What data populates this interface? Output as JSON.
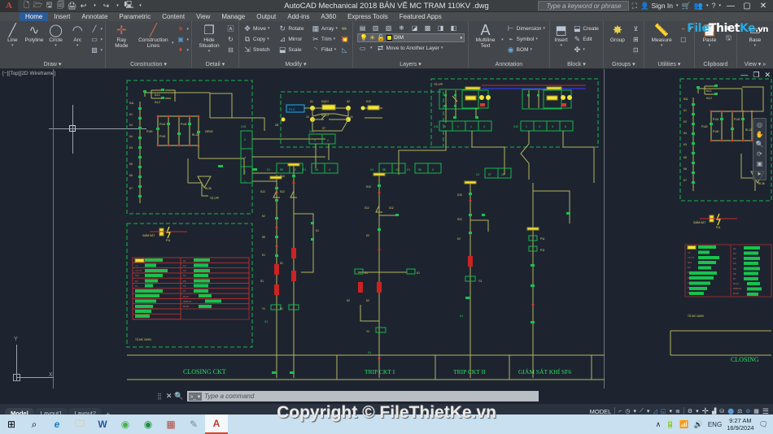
{
  "titlebar": {
    "app_icon": "autocad-A",
    "title": "AutoCAD Mechanical 2018    BẢN VẼ MC TRẠM 110KV  .dwg",
    "search_placeholder": "Type a keyword or phrase",
    "sign_in": "Sign In",
    "qat": [
      "new-icon",
      "open-icon",
      "save-icon",
      "saveas-icon",
      "plot-icon",
      "undo-icon",
      "redo-icon",
      "workspace-icon"
    ],
    "window_buttons": {
      "minimize": "—",
      "maximize": "▢",
      "close": "✕"
    }
  },
  "ribbon": {
    "tabs": [
      {
        "label": "Home",
        "active": true
      },
      {
        "label": "Insert",
        "active": false
      },
      {
        "label": "Annotate",
        "active": false
      },
      {
        "label": "Parametric",
        "active": false
      },
      {
        "label": "Content",
        "active": false
      },
      {
        "label": "View",
        "active": false
      },
      {
        "label": "Manage",
        "active": false
      },
      {
        "label": "Output",
        "active": false
      },
      {
        "label": "Add-ins",
        "active": false
      },
      {
        "label": "A360",
        "active": false
      },
      {
        "label": "Express Tools",
        "active": false
      },
      {
        "label": "Featured Apps",
        "active": false
      }
    ],
    "panels": [
      {
        "title": "Draw",
        "big_buttons": [
          {
            "label": "Line",
            "icon": "line-icon"
          },
          {
            "label": "Polyline",
            "icon": "polyline-icon"
          },
          {
            "label": "Circle",
            "icon": "circle-icon"
          },
          {
            "label": "Arc",
            "icon": "arc-icon"
          }
        ],
        "small_icons": [
          "hatch-line-icon",
          "rectangle-icon",
          "gradient-icon"
        ]
      },
      {
        "title": "Construction",
        "big_buttons": [
          {
            "label": "Ray\nMode",
            "icon": "ray-mode-icon"
          },
          {
            "label": "Construction\nLines",
            "icon": "construction-lines-icon"
          }
        ],
        "small_icons": [
          "centerline-icon",
          "holechart-icon",
          "fit-icon"
        ]
      },
      {
        "title": "Detail",
        "big_buttons": [
          {
            "label": "Hide\nSituation",
            "icon": "hide-situation-icon"
          }
        ],
        "small_icons": [
          "detail-a-icon",
          "revision-icon",
          "symbol-detail-icon"
        ]
      },
      {
        "title": "Modify",
        "commands": [
          {
            "label": "Move",
            "icon": "move-icon"
          },
          {
            "label": "Rotate",
            "icon": "rotate-icon"
          },
          {
            "label": "Array",
            "icon": "array-icon"
          },
          {
            "label": "Copy",
            "icon": "copy-icon"
          },
          {
            "label": "Mirror",
            "icon": "mirror-icon"
          },
          {
            "label": "Trim",
            "icon": "trim-icon"
          },
          {
            "label": "Stretch",
            "icon": "stretch-icon"
          },
          {
            "label": "Scale",
            "icon": "scale-icon"
          },
          {
            "label": "Fillet",
            "icon": "fillet-icon"
          }
        ],
        "extra_icons": [
          "edit-polyline-icon",
          "explode-icon",
          "chamfer-icon"
        ]
      },
      {
        "title": "Layers",
        "layer_icons": [
          "layer-prop-icon",
          "layer-iso-icon",
          "layer-unIso-icon",
          "layer-freeze-icon",
          "layer-off-icon",
          "layer-lock-icon",
          "layer-match-icon",
          "layer-prev-icon"
        ],
        "current_layer": "DIM",
        "layer_color": "#f5e11a",
        "sub_command": "Move to Another Layer"
      },
      {
        "title": "Annotation",
        "big_buttons": [
          {
            "label": "Multiline\nText",
            "icon": "mtext-icon"
          }
        ],
        "commands": [
          {
            "label": "Dimension",
            "icon": "dimension-icon"
          },
          {
            "label": "Symbol",
            "icon": "symbol-icon"
          },
          {
            "label": "BOM",
            "icon": "bom-icon"
          }
        ]
      },
      {
        "title": "Block",
        "big_buttons": [
          {
            "label": "Insert",
            "icon": "insert-block-icon"
          }
        ],
        "commands": [
          {
            "label": "Create",
            "icon": "create-block-icon"
          },
          {
            "label": "Edit",
            "icon": "edit-block-icon"
          }
        ],
        "extra_icons": [
          "block-attr-icon"
        ]
      },
      {
        "title": "Groups",
        "big_buttons": [
          {
            "label": "Group",
            "icon": "group-icon"
          }
        ],
        "small_icons": [
          "ungroup-icon",
          "group-edit-icon",
          "group-select-icon"
        ]
      },
      {
        "title": "Utilities",
        "big_buttons": [
          {
            "label": "Measure",
            "icon": "measure-icon"
          }
        ],
        "small_icons": [
          "quick-calc-icon",
          "point-style-icon"
        ]
      },
      {
        "title": "Clipboard",
        "big_buttons": [
          {
            "label": "Paste",
            "icon": "paste-icon"
          }
        ],
        "small_icons": [
          "copy-clip-icon",
          "paste-special-icon"
        ]
      },
      {
        "title": "View",
        "big_buttons": [
          {
            "label": "Base",
            "icon": "base-view-icon"
          }
        ]
      }
    ],
    "brand_watermark": {
      "part1": "File",
      "part2": "Thiet",
      "part3": "Ke",
      "part4": ".vn"
    }
  },
  "canvas": {
    "viewport_label": "[−][Top][2D Wireframe]",
    "ucs_x": "X",
    "ucs_y": "Y",
    "section_labels": [
      {
        "text": "CLOSING CKT"
      },
      {
        "text": "TRIP CKT I"
      },
      {
        "text": "TRIP CKT II"
      },
      {
        "text": "GIÁM SÁT KHÍ SF6"
      },
      {
        "text": "CLOSING"
      }
    ],
    "drawing_notes": [
      "TỦ LPP",
      "TỦ MC 110KV",
      "TỦ MC 110KV",
      "PLC",
      "KQ0.2",
      "KQ0.2",
      "KQ0.2",
      "K10",
      "K20",
      "X15",
      "X41",
      "X11",
      "X12",
      "X1",
      "X1",
      "X1",
      "X1",
      "X2",
      "S41",
      "S42",
      "S43",
      "S44",
      "RL1A",
      "RL1B",
      "RL16",
      "S7",
      "S12",
      "S13",
      "S19",
      "K1",
      "K2",
      "K3",
      "K4",
      "K5",
      "K6",
      "K7",
      "S4L",
      "S5",
      "Y1",
      "Y2",
      "Y3",
      "P11",
      "K20"
    ],
    "legend_tables": [
      {
        "left_rows": [
          "X1",
          "Y1",
          "Y2,Y3",
          "S12",
          "K2",
          "K5",
          "S13",
          "S5",
          "P2",
          "S1",
          "P11",
          "S7"
        ],
        "right_rows": [
          "K1",
          "K2",
          "K3",
          "K4",
          "K5",
          "K6",
          "K7",
          "RL12",
          "20RL16",
          "RL36"
        ]
      }
    ]
  },
  "command_line": {
    "placeholder": "Type a command",
    "chip": "command-prompt-icon",
    "close_icon": "✕",
    "search_icon": "search-icon"
  },
  "status_bar": {
    "layout_tabs": [
      {
        "label": "Model",
        "active": true
      },
      {
        "label": "Layout1",
        "active": false
      },
      {
        "label": "Layout2",
        "active": false
      }
    ],
    "add_layout": "+",
    "space_mode": "MODEL",
    "toggles": [
      "ortho-icon",
      "polar-tracking-icon",
      "osnap-icon",
      "isometric-icon",
      "annotation-visibility-icon",
      "annotation-scale-icon",
      "workspace-icon",
      "customization-icon",
      "hardware-accel-icon",
      "isolate-objects-icon",
      "clean-screen-icon",
      "fullscreen-icon",
      "menu-icon"
    ]
  },
  "watermark": "Copyright © FileThietKe.vn",
  "taskbar": {
    "items": [
      {
        "name": "start-button",
        "glyph": "⊞"
      },
      {
        "name": "search-button",
        "glyph": "⌕"
      },
      {
        "name": "edge-icon",
        "glyph": "e"
      },
      {
        "name": "file-explorer-icon",
        "glyph": "🗀"
      },
      {
        "name": "word-icon",
        "glyph": "W"
      },
      {
        "name": "unikey-icon",
        "glyph": "◉"
      },
      {
        "name": "chrome-icon",
        "glyph": "◉"
      },
      {
        "name": "app-icon",
        "glyph": "▦"
      },
      {
        "name": "paint-icon",
        "glyph": "✎"
      },
      {
        "name": "autocad-icon",
        "glyph": "A",
        "selected": true
      }
    ],
    "tray": {
      "chevron": "∧",
      "icons": [
        "battery-icon",
        "network-icon",
        "volume-icon"
      ],
      "language": "ENG",
      "time": "9:27 AM",
      "date": "16/9/2024",
      "notifications": "notification-icon"
    }
  }
}
